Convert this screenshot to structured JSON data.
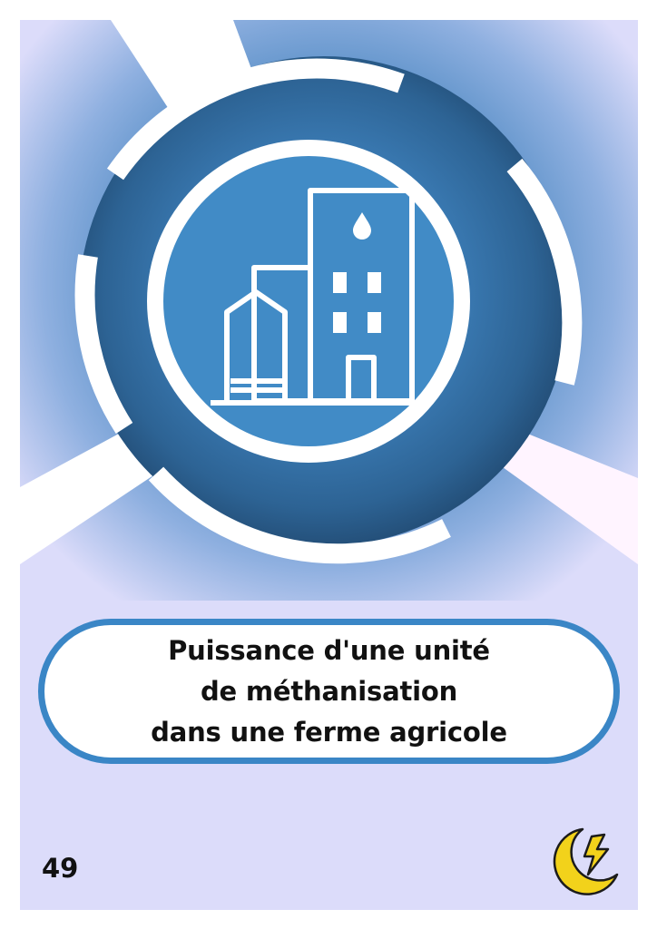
{
  "card": {
    "title": "Puissance d'une unité\nde méthanisation\ndans une ferme agricole",
    "number": "49",
    "colors": {
      "background": "#dcdcfa",
      "ring_dark": "#2f6d9e",
      "ring_light": "#4a8ec8",
      "frame_border": "#3a86c6",
      "logo_yellow": "#f2d21b"
    },
    "icons": {
      "central": "farm-silo-building-icon",
      "logo": "lightning-moon-logo-icon"
    }
  }
}
